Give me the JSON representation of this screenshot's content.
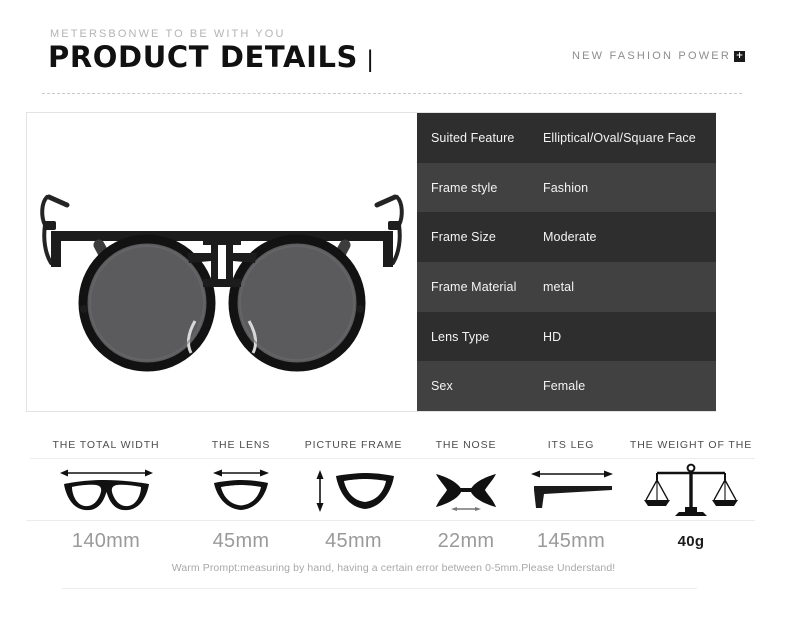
{
  "header": {
    "kicker": "METERSBONWE TO BE WITH YOU",
    "title": "PRODUCT DETAILS",
    "title_bar": "|",
    "right_text": "NEW FASHION POWER",
    "plus_badge": "+"
  },
  "product": {
    "image_name": "round-black-sunglasses-photo",
    "alt": "Round black metal frame sunglasses with dark lenses, front view"
  },
  "spec_table": {
    "rows": [
      {
        "key": "Suited Feature",
        "value": "Elliptical/Oval/Square Face",
        "shade": "dark"
      },
      {
        "key": "Frame style",
        "value": "Fashion",
        "shade": "light"
      },
      {
        "key": "Frame Size",
        "value": "Moderate",
        "shade": "dark"
      },
      {
        "key": "Frame Material",
        "value": "metal",
        "shade": "light"
      },
      {
        "key": "Lens Type",
        "value": "HD",
        "shade": "dark"
      },
      {
        "key": "Sex",
        "value": "Female",
        "shade": "light"
      }
    ]
  },
  "measurements": {
    "columns": [
      {
        "label": "THE TOTAL WIDTH",
        "icon": "glasses-total-width-icon",
        "value": "140mm",
        "emphasis": false
      },
      {
        "label": "THE LENS",
        "icon": "lens-width-icon",
        "value": "45mm",
        "emphasis": false
      },
      {
        "label": "PICTURE FRAME",
        "icon": "lens-height-icon",
        "value": "45mm",
        "emphasis": false
      },
      {
        "label": "THE NOSE",
        "icon": "nose-bridge-icon",
        "value": "22mm",
        "emphasis": false
      },
      {
        "label": "ITS LEG",
        "icon": "temple-arm-length-icon",
        "value": "145mm",
        "emphasis": false
      },
      {
        "label": "THE WEIGHT OF THE",
        "icon": "balance-scale-icon",
        "value": "40g",
        "emphasis": true
      }
    ],
    "warm_prompt": "Warm Prompt:measuring by hand, having a certain error between 0-5mm.Please Understand!"
  },
  "colors": {
    "table_dark": "#2e2e2e",
    "table_light": "#414141",
    "table_text": "#f4f4f4",
    "title": "#111111",
    "kicker": "#b4b4b4",
    "label": "#4d4d4d",
    "value": "#9a9a9a",
    "value_emphasis": "#1c1c1c",
    "prompt": "#a8a8a8",
    "border": "#e3e3e3"
  }
}
